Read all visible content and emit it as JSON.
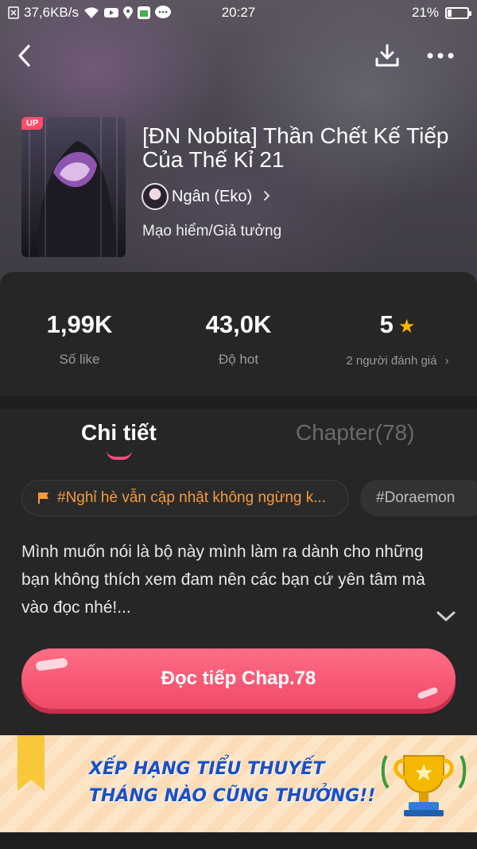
{
  "status_bar": {
    "net_speed": "37,6KB/s",
    "time": "20:27",
    "battery": "21%"
  },
  "book": {
    "cover_badge": "UP",
    "title": "[ĐN Nobita] Thần Chết Kế Tiếp Của Thế Kỉ 21",
    "author": "Ngân (Eko)",
    "genre": "Mạo hiểm/Giả tưởng"
  },
  "stats": {
    "likes_value": "1,99K",
    "likes_label": "Số like",
    "hot_value": "43,0K",
    "hot_label": "Độ hot",
    "rating_value": "5",
    "rating_label": "2 người đánh giá",
    "star_color": "#f5b800"
  },
  "tabs": {
    "details": "Chi tiết",
    "chapters": "Chapter(78)"
  },
  "tags": {
    "primary": "#Nghỉ hè vẫn cập nhật không ngừng k...",
    "secondary": "#Doraemon"
  },
  "description": "Mình muốn nói là bộ này mình làm ra dành cho những bạn không thích xem đam nên các bạn cứ yên tâm mà vào đọc nhé!...",
  "read_button": "Đọc tiếp Chap.78",
  "banner": {
    "line1": "XẾP HẠNG TIỂU THUYẾT",
    "line2": "THÁNG NÀO CŨNG THƯỞNG!!"
  },
  "colors": {
    "accent": "#ff4d7a",
    "tag_text": "#f59a3c",
    "banner_text": "#1a50c8"
  }
}
